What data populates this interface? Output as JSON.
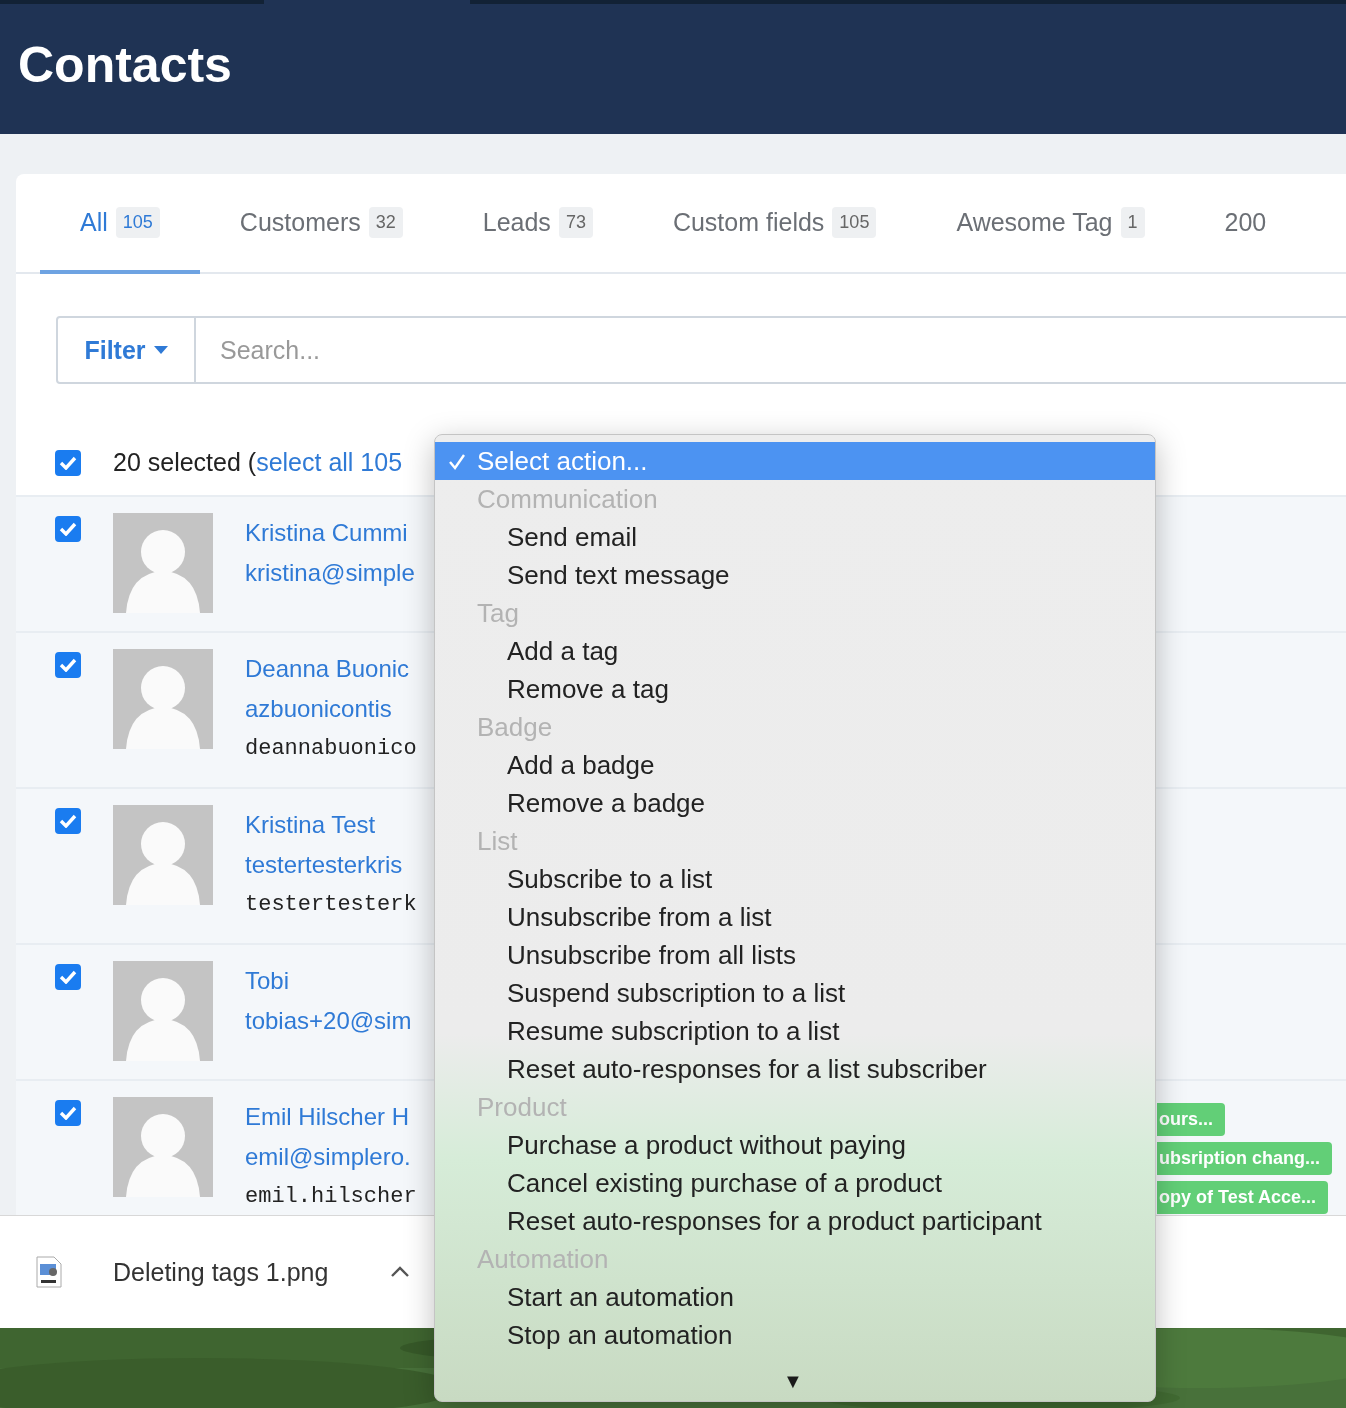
{
  "header": {
    "title": "Contacts"
  },
  "tabs": [
    {
      "label": "All",
      "count": "105",
      "selected": true
    },
    {
      "label": "Customers",
      "count": "32",
      "selected": false
    },
    {
      "label": "Leads",
      "count": "73",
      "selected": false
    },
    {
      "label": "Custom fields",
      "count": "105",
      "selected": false
    },
    {
      "label": "Awesome Tag",
      "count": "1",
      "selected": false
    },
    {
      "label": "200",
      "selected": false
    }
  ],
  "filter": {
    "button": "Filter"
  },
  "search": {
    "placeholder": "Search..."
  },
  "selection": {
    "checked": true,
    "text": "20 selected (",
    "link": "select all 105"
  },
  "contacts": [
    {
      "checked": true,
      "name": "Kristina Cummi",
      "email": "kristina@simple"
    },
    {
      "checked": true,
      "name": "Deanna Buonic",
      "email": "azbuonicontis",
      "extra": "deannabuonico"
    },
    {
      "checked": true,
      "name": "Kristina Test",
      "email": "testertesterkris",
      "extra": "testertesterk"
    },
    {
      "checked": true,
      "name": "Tobi",
      "email": "tobias+20@sim"
    },
    {
      "checked": true,
      "name": "Emil Hilscher H",
      "email": "emil@simplero.",
      "extra": "emil.hilscher",
      "tags": [
        "ours...",
        "ubsription chang...",
        "opy of Test Acce..."
      ]
    }
  ],
  "action_menu": {
    "options": [
      {
        "label": "Select action...",
        "selected": true
      }
    ],
    "groups": [
      {
        "label": "Communication",
        "items": [
          "Send email",
          "Send text message"
        ]
      },
      {
        "label": "Tag",
        "items": [
          "Add a tag",
          "Remove a tag"
        ]
      },
      {
        "label": "Badge",
        "items": [
          "Add a badge",
          "Remove a badge"
        ]
      },
      {
        "label": "List",
        "items": [
          "Subscribe to a list",
          "Unsubscribe from a list",
          "Unsubscribe from all lists",
          "Suspend subscription to a list",
          "Resume subscription to a list",
          "Reset auto-responses for a list subscriber"
        ]
      },
      {
        "label": "Product",
        "items": [
          "Purchase a product without paying",
          "Cancel existing purchase of a product",
          "Reset auto-responses for a product participant"
        ]
      },
      {
        "label": "Automation",
        "items": [
          "Start an automation",
          "Stop an automation"
        ]
      }
    ],
    "more": "▼"
  },
  "download_bar": {
    "file": "Deleting tags 1.png"
  }
}
